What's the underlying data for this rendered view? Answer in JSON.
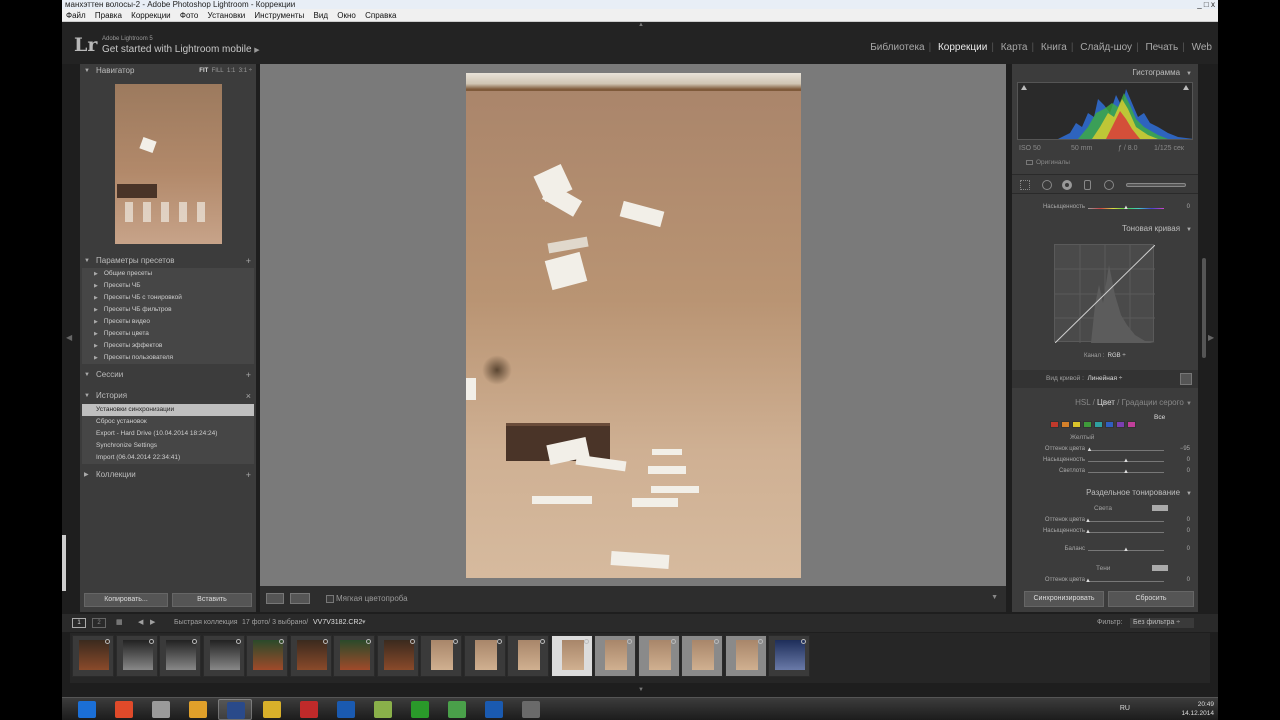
{
  "window": {
    "title": "манхэттен волосы-2 - Adobe Photoshop Lightroom - Коррекции",
    "controls": [
      "_",
      "□",
      "x"
    ]
  },
  "menu": [
    "Файл",
    "Правка",
    "Коррекции",
    "Фото",
    "Установки",
    "Инструменты",
    "Вид",
    "Окно",
    "Справка"
  ],
  "identity": {
    "logo": "Lr",
    "product": "Adobe Lightroom 5",
    "mobile": "Get started with Lightroom mobile",
    "mobile_arrow": "▶"
  },
  "modules": [
    "Библиотека",
    "Коррекции",
    "Карта",
    "Книга",
    "Слайд-шоу",
    "Печать",
    "Web"
  ],
  "modules_active": "Коррекции",
  "left_panel": {
    "navigator": {
      "title": "Навигатор",
      "zoom": [
        "FIT",
        "FILL",
        "1:1",
        "3:1"
      ]
    },
    "presets": {
      "title": "Параметры пресетов",
      "items": [
        "Общие пресеты",
        "Пресеты ЧБ",
        "Пресеты ЧБ с тонировкой",
        "Пресеты ЧБ фильтров",
        "Пресеты видео",
        "Пресеты цвета",
        "Пресеты эффектов",
        "Пресеты пользователя"
      ]
    },
    "sessions": {
      "title": "Сессии"
    },
    "history": {
      "title": "История",
      "items": [
        "Установки синхронизации",
        "Сброс установок",
        "Export - Hard Drive (10.04.2014 18:24:24)",
        "Synchronize Settings",
        "Import (06.04.2014 22:34:41)"
      ]
    },
    "collections": {
      "title": "Коллекции"
    },
    "copy_button": "Копировать...",
    "paste_button": "Вставить"
  },
  "toolbar": {
    "soft_proof": "Мягкая цветопроба"
  },
  "right_panel": {
    "histogram_title": "Гистограмма",
    "exif": {
      "iso": "ISO 50",
      "focal": "50 mm",
      "aperture": "ƒ / 8.0",
      "shutter": "1/125 сек"
    },
    "originals": "Оригиналы",
    "saturation": {
      "label": "Насыщенность",
      "value": "0"
    },
    "tone_curve_title": "Тоновая кривая",
    "channel_label": "Канал :",
    "channel_value": "RGB ÷",
    "curve_type_label": "Вид кривой :",
    "curve_type_value": "Линейная ÷",
    "hsl_tabs": [
      "HSL",
      "Цвет",
      "Градации серого"
    ],
    "hsl_active": "Цвет",
    "swatch_all": "Все",
    "swatch_colors": [
      "#c0392b",
      "#d4802a",
      "#d9c32b",
      "#3f9a3a",
      "#2fa0a0",
      "#2f5fc0",
      "#7a3fb0",
      "#c03f9a"
    ],
    "hsl_color_name": "Желтый",
    "hsl_sliders": [
      {
        "label": "Оттенок цвета",
        "value": "−95",
        "level": 0.02
      },
      {
        "label": "Насыщенность",
        "value": "0",
        "level": 0.5
      },
      {
        "label": "Светлота",
        "value": "0",
        "level": 0.5
      }
    ],
    "split_title": "Раздельное тонирование",
    "split_highlights": "Света",
    "split_sliders_top": [
      {
        "label": "Оттенок цвета",
        "value": "0",
        "level": 0.0
      },
      {
        "label": "Насыщенность",
        "value": "0",
        "level": 0.0
      }
    ],
    "balance": {
      "label": "Баланс",
      "value": "0",
      "level": 0.5
    },
    "split_shadows": "Тени",
    "split_sliders_bottom": [
      {
        "label": "Оттенок цвета",
        "value": "0",
        "level": 0.0
      }
    ],
    "sync_button": "Синхронизировать",
    "reset_button": "Сбросить"
  },
  "filmstrip_bar": {
    "pages": [
      "1",
      "2"
    ],
    "source": "Быстрая коллекция",
    "info": "17 фото/ 3 выбрано/",
    "filename": "VV7V3182.CR2",
    "dropdown_arrow": "▾",
    "filter_label": "Фильтр:",
    "filter_value": "Без фильтра"
  },
  "taskbar": {
    "language": "RU",
    "time": "20:49",
    "date": "14.12.2014",
    "apps": [
      "Windows Start",
      "Apps",
      "Explorer",
      "Chrome",
      "Lightroom",
      "App",
      "Opera",
      "Photoshop",
      "Notes",
      "uTorrent",
      "App",
      "Photoshop",
      "Explorer"
    ]
  }
}
